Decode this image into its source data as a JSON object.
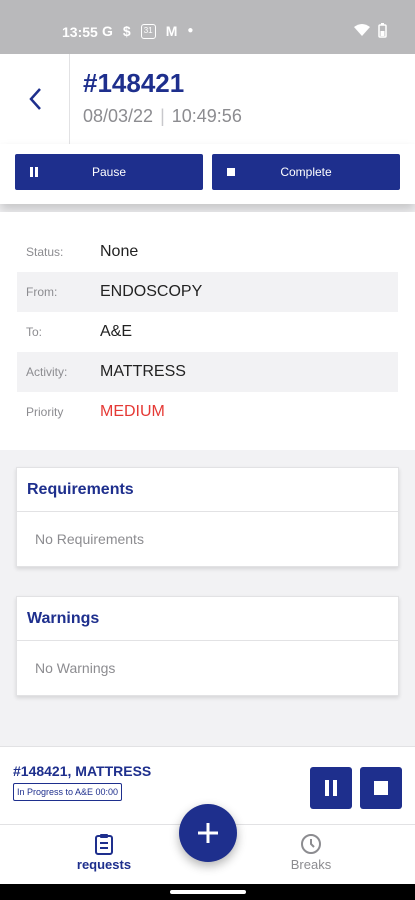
{
  "status_bar": {
    "time": "13:55",
    "icons": [
      "google-icon",
      "s-icon",
      "calendar-31-icon",
      "gmail-icon",
      "dot-icon",
      "wifi-icon",
      "battery-icon"
    ],
    "calendar_day": "31"
  },
  "header": {
    "request_id": "#148421",
    "date": "08/03/22",
    "time": "10:49:56"
  },
  "actions": {
    "pause_label": "Pause",
    "complete_label": "Complete"
  },
  "details": {
    "status": {
      "label": "Status:",
      "value": "None"
    },
    "from": {
      "label": "From:",
      "value": "ENDOSCOPY"
    },
    "to": {
      "label": "To:",
      "value": "A&E"
    },
    "activity": {
      "label": "Activity:",
      "value": "MATTRESS"
    },
    "priority": {
      "label": "Priority",
      "value": "MEDIUM"
    }
  },
  "requirements": {
    "title": "Requirements",
    "empty_text": "No Requirements"
  },
  "warnings": {
    "title": "Warnings",
    "empty_text": "No Warnings"
  },
  "current_job": {
    "title": "#148421, MATTRESS",
    "status": "In Progress to A&E 00:00"
  },
  "nav": {
    "requests_label": "requests",
    "breaks_label": "Breaks"
  },
  "colors": {
    "primary": "#1e2f8d",
    "priority_medium": "#e53935",
    "muted": "#8c8c90"
  }
}
